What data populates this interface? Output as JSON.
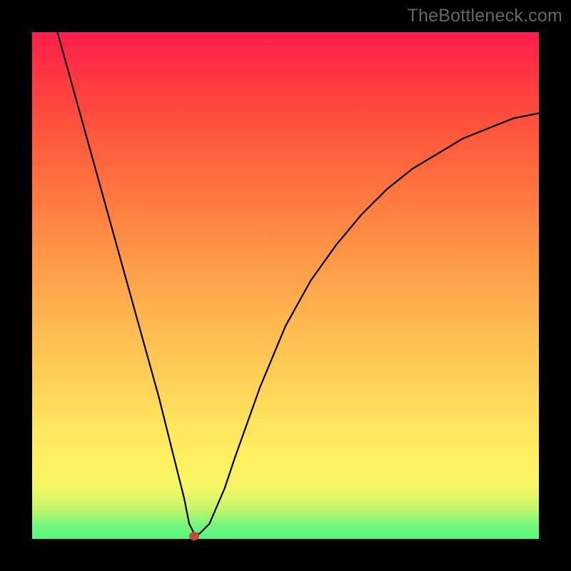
{
  "watermark": "TheBottleneck.com",
  "chart_data": {
    "type": "line",
    "title": "",
    "xlabel": "",
    "ylabel": "",
    "xlim": [
      0,
      100
    ],
    "ylim": [
      0,
      100
    ],
    "grid": false,
    "legend": false,
    "series": [
      {
        "name": "curve",
        "x": [
          5,
          10,
          15,
          20,
          25,
          28,
          30,
          31,
          32,
          33,
          35,
          38,
          40,
          45,
          50,
          55,
          60,
          65,
          70,
          75,
          80,
          85,
          90,
          95,
          100
        ],
        "y": [
          100,
          82,
          64,
          46,
          28,
          16,
          8,
          3,
          1,
          1,
          3,
          10,
          16,
          30,
          42,
          51,
          58,
          64,
          69,
          73,
          76,
          79,
          81,
          83,
          84
        ]
      }
    ],
    "marker": {
      "x": 32,
      "y": 0.5,
      "color": "#c44a3d"
    },
    "background_gradient": [
      {
        "pos": 0,
        "color": "#55f782"
      },
      {
        "pos": 3,
        "color": "#7af77a"
      },
      {
        "pos": 6,
        "color": "#c7f66a"
      },
      {
        "pos": 10,
        "color": "#f4f765"
      },
      {
        "pos": 15,
        "color": "#fff161"
      },
      {
        "pos": 22,
        "color": "#ffe55e"
      },
      {
        "pos": 30,
        "color": "#ffd358"
      },
      {
        "pos": 40,
        "color": "#ffbe52"
      },
      {
        "pos": 50,
        "color": "#ffa64b"
      },
      {
        "pos": 60,
        "color": "#ff8c45"
      },
      {
        "pos": 70,
        "color": "#ff723f"
      },
      {
        "pos": 80,
        "color": "#ff573c"
      },
      {
        "pos": 90,
        "color": "#ff3a40"
      },
      {
        "pos": 100,
        "color": "#ff1d4c"
      }
    ]
  }
}
